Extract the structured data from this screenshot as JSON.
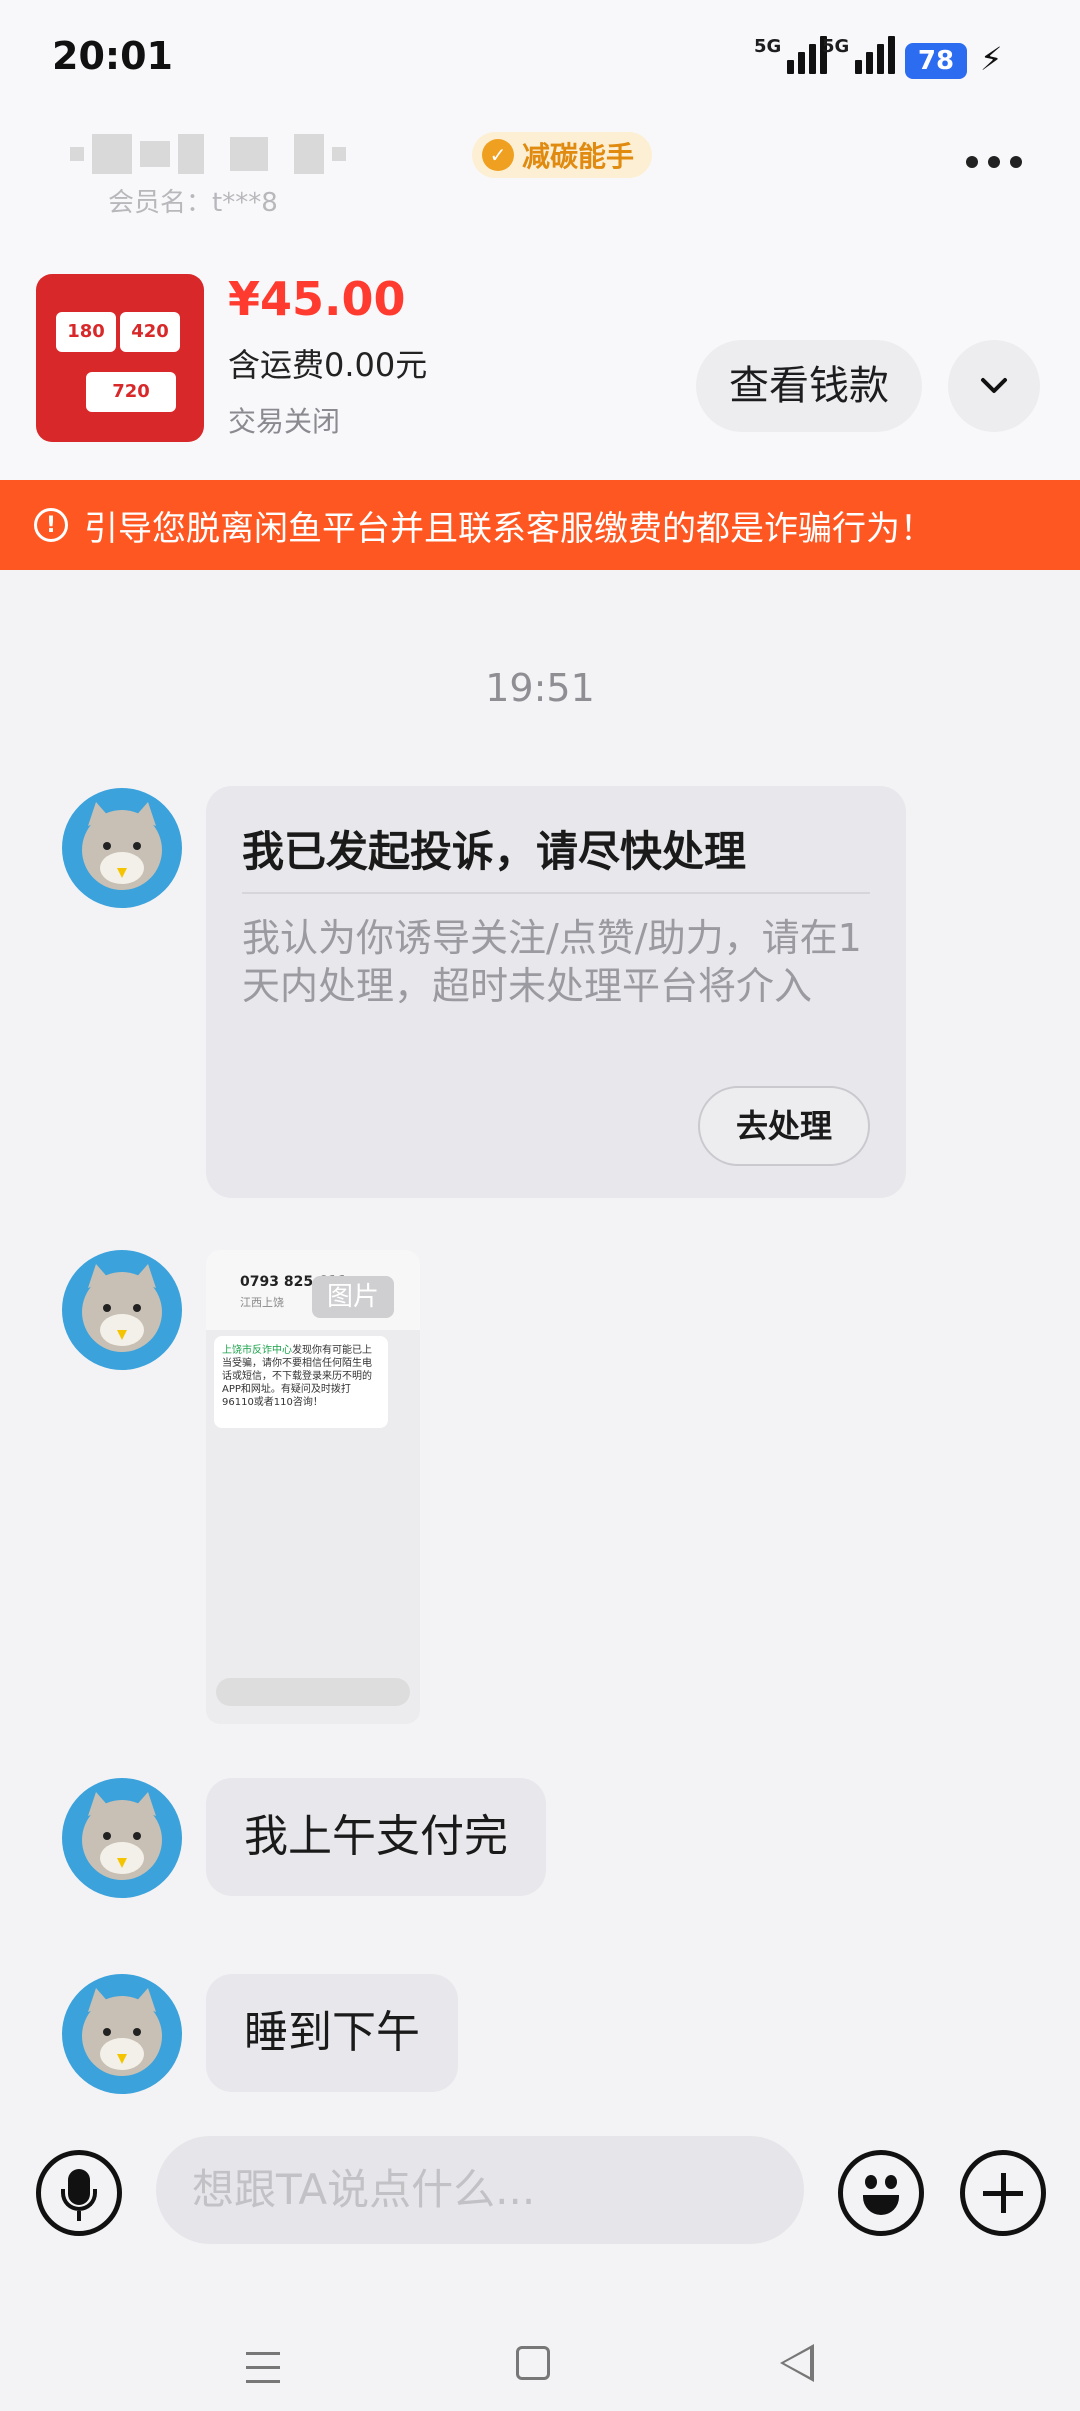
{
  "status_bar": {
    "time": "20:01",
    "network1": "5G",
    "network2": "5G",
    "battery": "78"
  },
  "header": {
    "badge": "减碳能手",
    "member_label": "会员名：t***8"
  },
  "product": {
    "price": "¥45.00",
    "shipping": "含运费0.00元",
    "status": "交易关闭",
    "check_button": "查看钱款"
  },
  "warning": {
    "text": "引导您脱离闲鱼平台并且联系客服缴费的都是诈骗行为！"
  },
  "chat": {
    "timestamp": "19:51",
    "complaint": {
      "title": "我已发起投诉，请尽快处理",
      "body": "我认为你诱导关注/点赞/助力，请在1天内处理，超时未处理平台将介入",
      "action": "去处理"
    },
    "image": {
      "tag": "图片",
      "phone_title": "0793 825 611",
      "phone_sub": "江西上饶",
      "sms_text": "发现你有可能已上当受骗，请你不要相信任何陌生电话或短信，不下载登录来历不明的APP和网址。有疑问及时拨打96110或者110咨询！",
      "sms_sender": "上饶市反诈中心"
    },
    "messages": [
      "我上午支付完",
      "睡到下午"
    ]
  },
  "input": {
    "placeholder": "想跟TA说点什么..."
  },
  "colors": {
    "accent": "#ff5722",
    "price": "#ff3b30",
    "badge": "#e08a10"
  }
}
